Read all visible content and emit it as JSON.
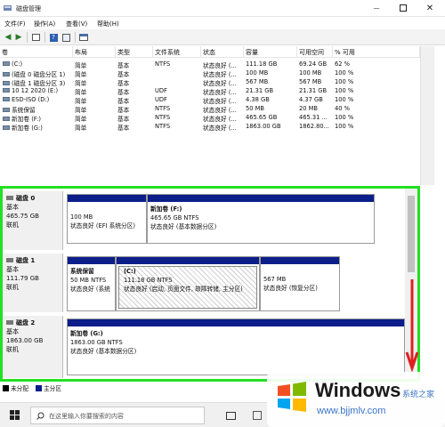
{
  "window": {
    "title": "磁盘管理"
  },
  "menu": [
    "文件(F)",
    "操作(A)",
    "查看(V)",
    "帮助(H)"
  ],
  "volume_columns": [
    "卷",
    "布局",
    "类型",
    "文件系统",
    "状态",
    "容量",
    "可用空间",
    "% 可用"
  ],
  "volumes": [
    [
      "(C:)",
      "简单",
      "基本",
      "NTFS",
      "状态良好 (...",
      "111.18 GB",
      "69.24 GB",
      "62 %"
    ],
    [
      "(磁盘 0 磁盘分区 1)",
      "简单",
      "基本",
      "",
      "状态良好 (...",
      "100 MB",
      "100 MB",
      "100 %"
    ],
    [
      "(磁盘 1 磁盘分区 3)",
      "简单",
      "基本",
      "",
      "状态良好 (...",
      "567 MB",
      "567 MB",
      "100 %"
    ],
    [
      "10 12 2020 (E:)",
      "简单",
      "基本",
      "UDF",
      "状态良好 (...",
      "21.31 GB",
      "21.31 GB",
      "100 %"
    ],
    [
      "ESD-ISO (D:)",
      "简单",
      "基本",
      "UDF",
      "状态良好 (...",
      "4.38 GB",
      "4.37 GB",
      "100 %"
    ],
    [
      "系统保留",
      "简单",
      "基本",
      "NTFS",
      "状态良好 (...",
      "50 MB",
      "20 MB",
      "40 %"
    ],
    [
      "新加卷 (F:)",
      "简单",
      "基本",
      "NTFS",
      "状态良好 (...",
      "465.65 GB",
      "465.31 ...",
      "100 %"
    ],
    [
      "新加卷 (G:)",
      "简单",
      "基本",
      "NTFS",
      "状态良好 (...",
      "1863.00 GB",
      "1862.80...",
      "100 %"
    ]
  ],
  "disks": [
    {
      "name": "磁盘 0",
      "type": "基本",
      "size": "465.75 GB",
      "status": "联机",
      "partitions": [
        {
          "title": "",
          "line1": "100 MB",
          "line2": "状态良好 (EFI 系统分区)"
        },
        {
          "title": "新加卷  (F:)",
          "line1": "465.65 GB NTFS",
          "line2": "状态良好 (基本数据分区)"
        }
      ]
    },
    {
      "name": "磁盘 1",
      "type": "基本",
      "size": "111.79 GB",
      "status": "联机",
      "partitions": [
        {
          "title": "系统保留",
          "line1": "50 MB NTFS",
          "line2": "状态良好 (系统"
        },
        {
          "title": "(C:)",
          "line1": "111.18 GB NTFS",
          "line2": "状态良好 (启动, 页面文件, 故障转储, 主分区)"
        },
        {
          "title": "",
          "line1": "567 MB",
          "line2": "状态良好 (恢复分区)"
        }
      ]
    },
    {
      "name": "磁盘 2",
      "type": "基本",
      "size": "1863.00 GB",
      "status": "联机",
      "partitions": [
        {
          "title": "新加卷  (G:)",
          "line1": "1863.00 GB NTFS",
          "line2": "状态良好 (基本数据分区)"
        }
      ]
    }
  ],
  "legend": {
    "unallocated": "未分配",
    "primary": "主分区"
  },
  "taskbar": {
    "search_placeholder": "在这里输入你要搜索的内容"
  },
  "watermark": {
    "brand": "Windows",
    "suffix": "系统之家",
    "url": "www.bjjmlv.com"
  },
  "colors": {
    "partition_bar": "#0c1e8a",
    "highlight": "#22e022",
    "annotation": "#e02020"
  }
}
